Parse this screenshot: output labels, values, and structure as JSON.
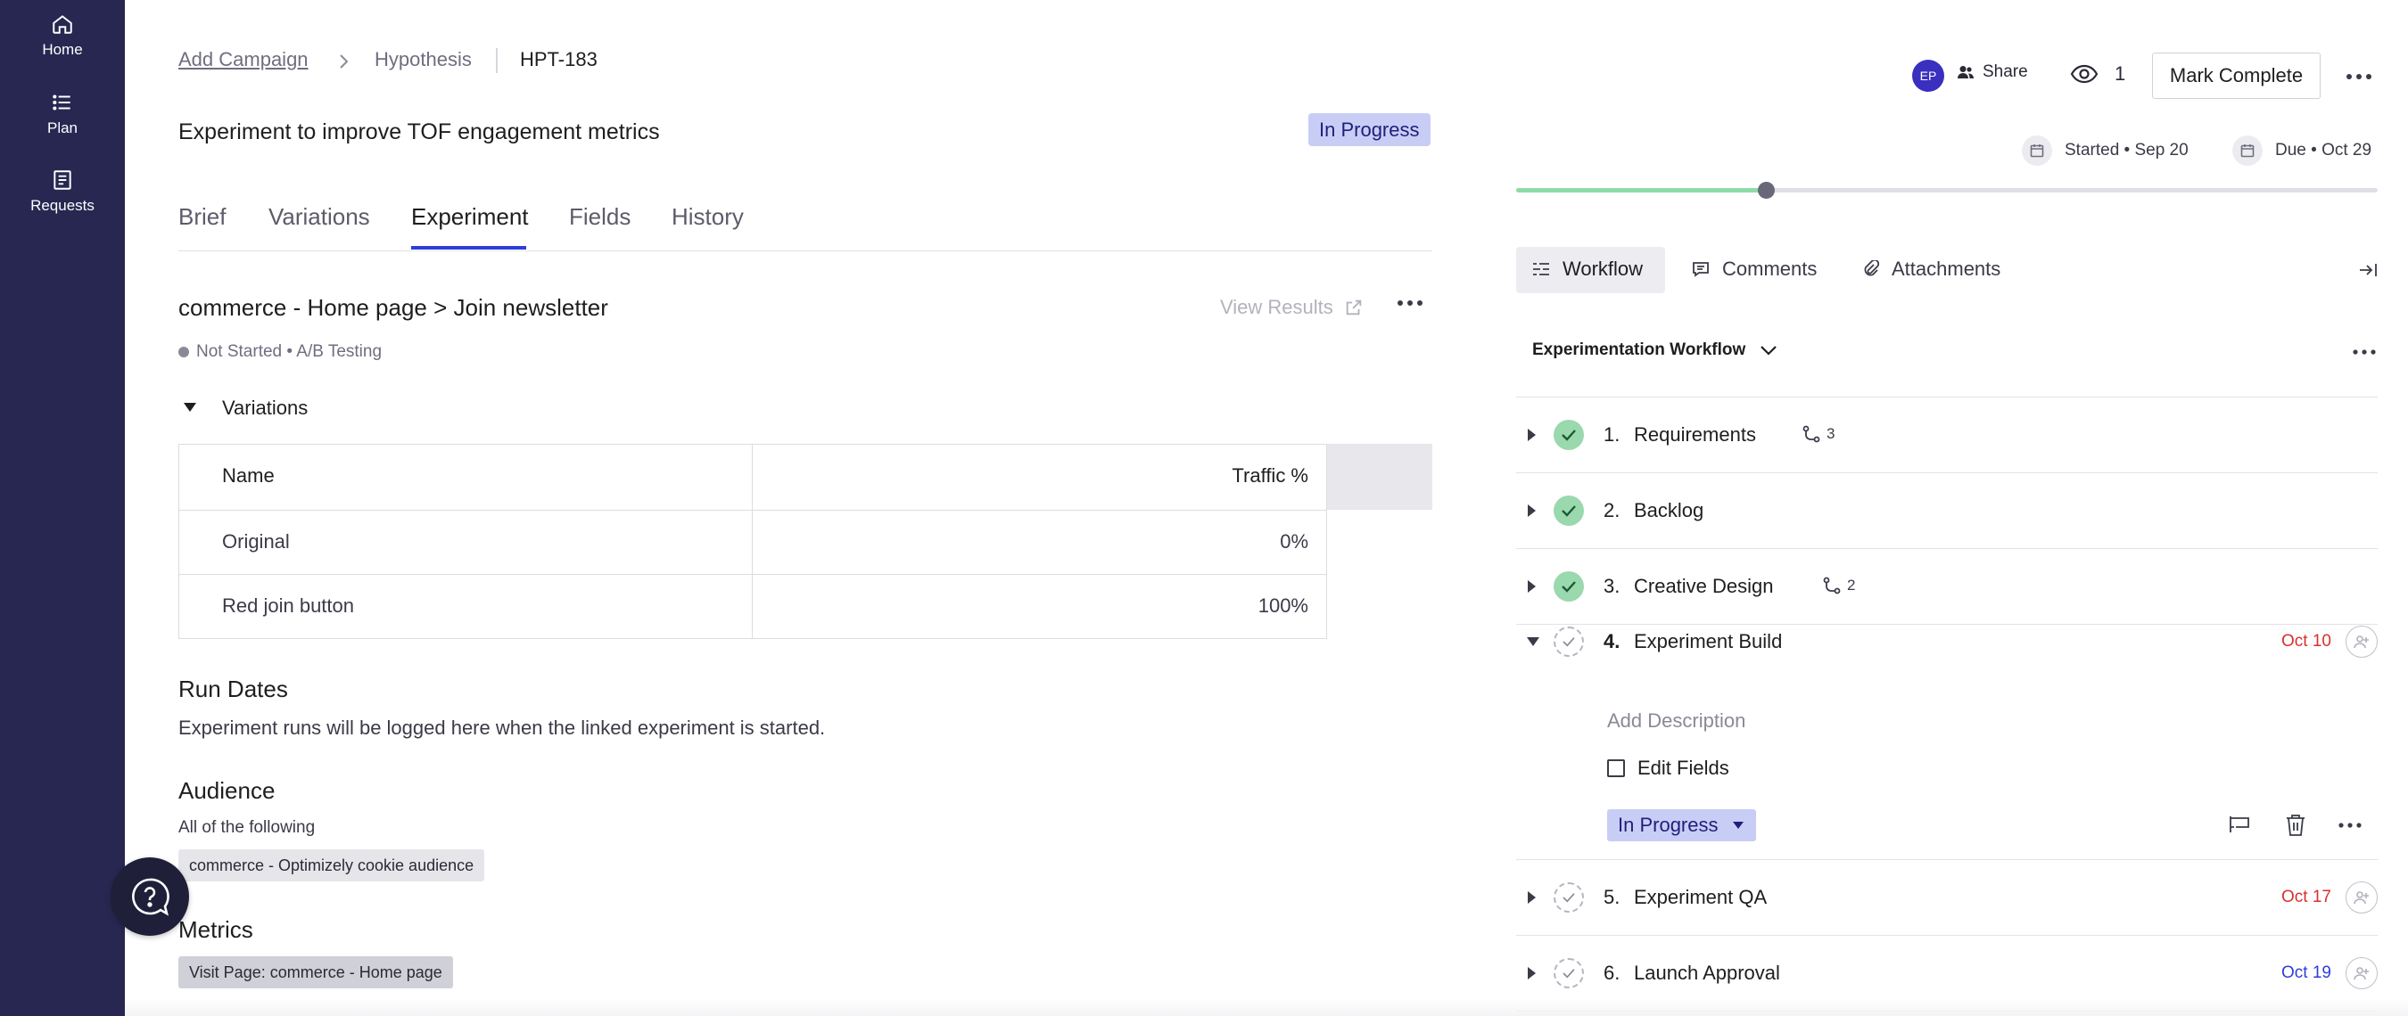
{
  "colors": {
    "sidebar_bg": "#272752",
    "accent": "#2f3ed8",
    "status_pill": "#c8cdf6",
    "done_check": "#9ad8ad",
    "due_red": "#d8302f",
    "due_blue": "#2f3ed8"
  },
  "sidebar": {
    "items": [
      {
        "label": "Home",
        "icon": "home-icon"
      },
      {
        "label": "Plan",
        "icon": "list-icon"
      },
      {
        "label": "Requests",
        "icon": "document-icon"
      }
    ]
  },
  "breadcrumb": {
    "items": [
      "Add Campaign",
      "Hypothesis",
      "HPT-183"
    ]
  },
  "page": {
    "title": "Experiment to improve TOF engagement metrics",
    "status": "In Progress"
  },
  "tabs": [
    "Brief",
    "Variations",
    "Experiment",
    "Fields",
    "History"
  ],
  "active_tab": "Experiment",
  "experiment": {
    "title": "commerce - Home page > Join newsletter",
    "view_results": "View Results",
    "meta": "Not Started • A/B Testing",
    "variations_heading": "Variations",
    "table": {
      "headers": [
        "Name",
        "Traffic %"
      ],
      "rows": [
        {
          "name": "Original",
          "traffic": "0%"
        },
        {
          "name": "Red join button",
          "traffic": "100%"
        }
      ]
    },
    "run_dates": {
      "heading": "Run Dates",
      "text": "Experiment runs will be logged here when the linked experiment is started."
    },
    "audience": {
      "heading": "Audience",
      "subtitle": "All of the following",
      "chip": "commerce - Optimizely cookie audience"
    },
    "metrics": {
      "heading": "Metrics",
      "chip": "Visit Page: commerce - Home page"
    }
  },
  "header": {
    "avatar_initials": "EP",
    "share_label": "Share",
    "watchers": "1",
    "mark_complete": "Mark Complete",
    "started": "Started • Sep 20",
    "due": "Due • Oct 29",
    "progress_fraction": 0.29
  },
  "right_tabs": [
    "Workflow",
    "Comments",
    "Attachments"
  ],
  "workflow": {
    "name": "Experimentation Workflow",
    "steps": [
      {
        "num": "1.",
        "name": "Requirements",
        "done": true,
        "branches": "3",
        "date": ""
      },
      {
        "num": "2.",
        "name": "Backlog",
        "done": true,
        "branches": "",
        "date": ""
      },
      {
        "num": "3.",
        "name": "Creative Design",
        "done": true,
        "branches": "2",
        "date": ""
      },
      {
        "num": "4.",
        "name": "Experiment Build",
        "done": false,
        "branches": "",
        "date": "Oct 10",
        "date_color": "red"
      },
      {
        "num": "5.",
        "name": "Experiment QA",
        "done": false,
        "branches": "",
        "date": "Oct 17",
        "date_color": "red"
      },
      {
        "num": "6.",
        "name": "Launch Approval",
        "done": false,
        "branches": "",
        "date": "Oct 19",
        "date_color": "blue"
      }
    ],
    "expanded": {
      "add_description": "Add Description",
      "edit_fields": "Edit Fields",
      "status": "In Progress"
    }
  }
}
